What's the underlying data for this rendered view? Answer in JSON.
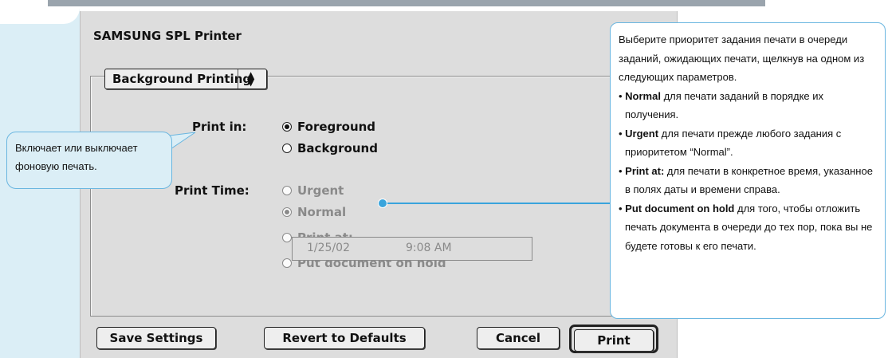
{
  "dialog": {
    "title": "SAMSUNG SPL Printer",
    "popup_label": "Background Printing",
    "popup_arrows": "▲▼",
    "print_in": {
      "label": "Print in:",
      "options": [
        {
          "label": "Foreground",
          "selected": true
        },
        {
          "label": "Background",
          "selected": false
        }
      ]
    },
    "print_time": {
      "label": "Print Time:",
      "options": [
        {
          "label": "Urgent",
          "selected": false
        },
        {
          "label": "Normal",
          "selected": true
        },
        {
          "label": "Print at:",
          "selected": false
        },
        {
          "label": "Put document on hold",
          "selected": false
        }
      ],
      "date": "1/25/02",
      "time": "9:08 AM"
    },
    "buttons": {
      "save": "Save Settings",
      "revert": "Revert to Defaults",
      "cancel": "Cancel",
      "print": "Print"
    }
  },
  "callout_left": {
    "line1": "Включает или выключает",
    "line2": "фоновую печать."
  },
  "callout_right": {
    "intro": "Выберите приоритет задания печати в очереди заданий, ожидающих печати, щелкнув на одном из следующих параметров.",
    "bullets": [
      {
        "term": "Normal",
        "text": " для печати заданий в порядке их получения."
      },
      {
        "term": "Urgent",
        "text": " для печати прежде любого задания с приоритетом “Normal”."
      },
      {
        "term": "Print at:",
        "text": " для печати в конкретное время, указанное в полях даты и времени справа."
      },
      {
        "term": "Put document on hold",
        "text": " для того, чтобы отложить печать документа в очереди до тех пор, пока вы не будете готовы к его печати."
      }
    ]
  },
  "colors": {
    "accent": "#39a4dc",
    "callout_fill": "#dbeef6",
    "dialog_bg": "#dddddd"
  }
}
